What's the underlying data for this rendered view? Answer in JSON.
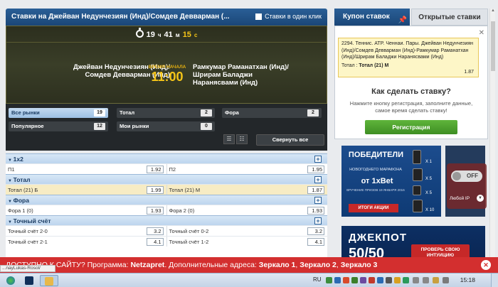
{
  "header": {
    "title": "Ставки на Джейван Недунчезиян (Инд)/Сомдев Девварман (...",
    "one_click": "Ставки в один клик"
  },
  "match": {
    "timer": {
      "hours": "19",
      "h_unit": "ч",
      "minutes": "41",
      "m_unit": "м",
      "seconds": "15",
      "s_unit": "с"
    },
    "team1": "Джейван Недунчезиян (Инд)/Сомдев Девварман (Инд)",
    "team2": "Рамкумар Раманатхан (Инд)/Шрирам Баладжи Наранясвами (Инд)",
    "start_label": "ВРЕМЯ НАЧАЛА",
    "start_time": "11:00"
  },
  "filters": {
    "all_markets": {
      "label": "Все рынки",
      "count": "19"
    },
    "total": {
      "label": "Тотал",
      "count": "2"
    },
    "handicap": {
      "label": "Фора",
      "count": "2"
    },
    "popular": {
      "label": "Популярное",
      "count": "12"
    },
    "my_markets": {
      "label": "Мои рынки",
      "count": "0"
    },
    "collapse_all": "Свернуть все"
  },
  "markets": [
    {
      "title": "1х2",
      "rows": [
        {
          "l": "П1",
          "lo": "1.92",
          "r": "П2",
          "ro": "1.95",
          "hl": false
        }
      ]
    },
    {
      "title": "Тотал",
      "rows": [
        {
          "l": "Тотал (21) Б",
          "lo": "1.99",
          "r": "Тотал (21) М",
          "ro": "1.87",
          "hl": true
        }
      ]
    },
    {
      "title": "Фора",
      "rows": [
        {
          "l": "Фора 1 (0)",
          "lo": "1.93",
          "r": "Фора 2 (0)",
          "ro": "1.93",
          "hl": false
        }
      ]
    },
    {
      "title": "Точный счёт",
      "rows": [
        {
          "l": "Точный счёт 2-0",
          "lo": "3.2",
          "r": "Точный счёт 0-2",
          "ro": "3.2",
          "hl": false
        },
        {
          "l": "Точный счёт 2-1",
          "lo": "4.1",
          "r": "Точный счёт 1-2",
          "ro": "4.1",
          "hl": false
        }
      ]
    }
  ],
  "coupon": {
    "tab_active": "Купон ставок",
    "tab_other": "Открытые ставки",
    "bet_text": "2294. Теннис. ATP. Ченнаи. Пары. Джейван Недунчезиян (Инд)/Сомдев Девварман (Инд)-Рамкумар Раманатхан (Инд)/Шрирам Баладжи Наранясвами (Инд)",
    "bet_sel_prefix": "Тотал :",
    "bet_sel": "Тотал (21) М",
    "bet_price": "1.87",
    "howto_title": "Как сделать ставку?",
    "howto_text": "Нажмите кнопку регистрация, заполните данные, самое время сделать ставку!",
    "register": "Регистрация"
  },
  "ads": {
    "winners": "ПОБЕДИТЕЛИ",
    "marathon": "НОВОГОДНЕГО МАРАФОНА",
    "from": "от",
    "brand": "1xBet",
    "tiny": "ВРУЧЕНИЕ ПРИЗОВ 19 ЯНВАРЯ 2016",
    "results": "ИТОГИ АКЦИИ",
    "qty": [
      "X 1",
      "X 5",
      "X 5",
      "X 10"
    ],
    "jackpot": "ДЖЕКПОТ",
    "jackpot_num": "50/50",
    "check_luck": "ПРОВЕРЬ СВОЮ ИНТУИЦИЮ"
  },
  "vpn": {
    "state": "OFF",
    "label": "Любой IP"
  },
  "notification": {
    "prefix": "ДОСТУПНО К САЙТУ? Программа:",
    "program": "Netzapret",
    "middle": ". Дополнительные адреса:",
    "m1": "Зеркало 1",
    "m2": "Зеркало 2",
    "m3": "Зеркало 3"
  },
  "url_fragment": "...nayLukas-Rosol/",
  "taskbar": {
    "lang": "RU",
    "time": "15:18"
  },
  "colors": {
    "header": "#1f4e85",
    "accent_yellow": "#f5c518",
    "register": "#4a9e2c",
    "notify": "#d32f2f"
  }
}
